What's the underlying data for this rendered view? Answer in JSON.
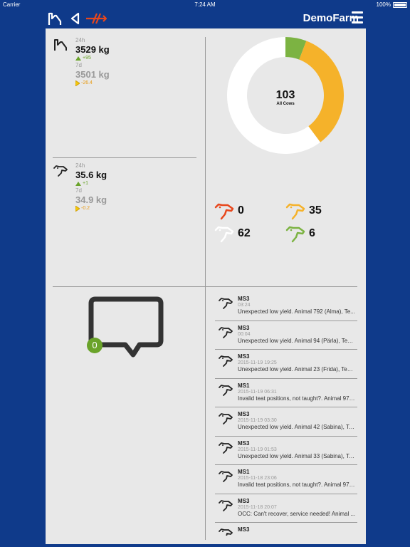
{
  "status_bar": {
    "carrier": "Carrier",
    "time": "7:24 AM",
    "battery": "100%"
  },
  "header": {
    "farm_name": "DemoFarm"
  },
  "milk": {
    "label_24h": "24h",
    "value_24h": "3529 kg",
    "delta_24h": "+95",
    "label_7d": "7d",
    "value_7d": "3501 kg",
    "delta_7d": "-26.4"
  },
  "feed": {
    "label_24h": "24h",
    "value_24h": "35.6 kg",
    "delta_24h": "+1",
    "label_7d": "7d",
    "value_7d": "34.9 kg",
    "delta_7d": "-0.2"
  },
  "cows": {
    "total": "103",
    "total_label": "All Cows",
    "groups": [
      {
        "count": "0",
        "color": "#e8471c",
        "value": 0
      },
      {
        "count": "35",
        "color": "#f5b22a",
        "value": 35
      },
      {
        "count": "62",
        "color": "#ffffff",
        "value": 62
      },
      {
        "count": "6",
        "color": "#7cb342",
        "value": 6
      }
    ]
  },
  "messages": {
    "unread_count": "0",
    "items": [
      {
        "title": "MS3",
        "time": "03:24",
        "text": "Unexpected low yield. Animal 792 (Alma), Te..."
      },
      {
        "title": "MS3",
        "time": "00:04",
        "text": "Unexpected low yield. Animal 94 (Pärla), Teat..."
      },
      {
        "title": "MS3",
        "time": "2015-11-19 19:25",
        "text": "Unexpected low yield. Animal 23 (Frida), Teat..."
      },
      {
        "title": "MS1",
        "time": "2015-11-19 06:31",
        "text": "Invalid teat positions, not taught?. Animal 97 (..."
      },
      {
        "title": "MS3",
        "time": "2015-11-19 03:30",
        "text": "Unexpected low yield. Animal 42 (Sabina), Te..."
      },
      {
        "title": "MS3",
        "time": "2015-11-19 01:53",
        "text": "Unexpected low yield. Animal 33 (Sabina), Te..."
      },
      {
        "title": "MS1",
        "time": "2015-11-18 23:06",
        "text": "Invalid teat positions, not taught?. Animal 97 (..."
      },
      {
        "title": "MS3",
        "time": "2015-11-18 20:07",
        "text": "OCC: Can't recover, service needed! Animal ..."
      },
      {
        "title": "MS3",
        "time": "",
        "text": ""
      }
    ]
  },
  "colors": {
    "accent_blue": "#0f3a8a",
    "up_green": "#6aa32a",
    "flat_orange": "#e79a12"
  }
}
